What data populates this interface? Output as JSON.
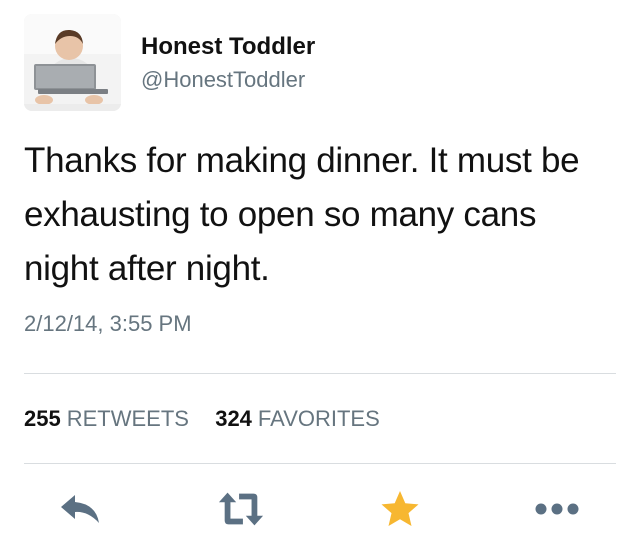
{
  "user": {
    "display_name": "Honest Toddler",
    "handle": "@HonestToddler"
  },
  "tweet": {
    "text": "Thanks for making dinner. It must be exhausting to open so many cans night after night.",
    "timestamp": "2/12/14, 3:55 PM"
  },
  "stats": {
    "retweets_count": "255",
    "retweets_label": "RETWEETS",
    "favorites_count": "324",
    "favorites_label": "FAVORITES"
  },
  "actions": {
    "reply_icon": "reply-icon",
    "retweet_icon": "retweet-icon",
    "favorite_icon": "star-icon",
    "more_icon": "more-dots-icon"
  },
  "colors": {
    "text": "#111111",
    "secondary": "#66757f",
    "action_icon": "#5b7083",
    "favorite": "#f7b731",
    "divider": "#d9dde0"
  }
}
